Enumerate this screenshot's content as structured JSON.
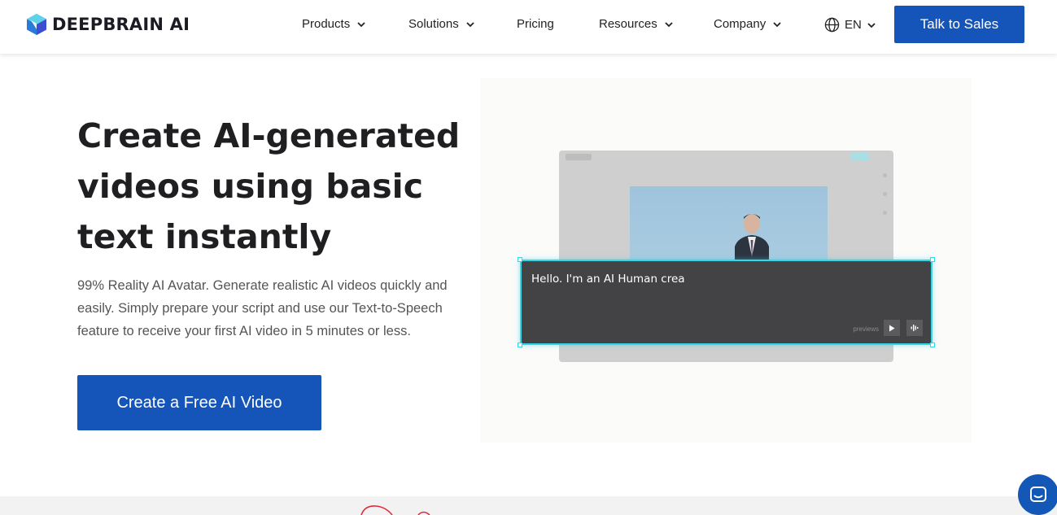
{
  "brand": {
    "name": "DEEPBRAIN AI",
    "accent": "#1555b9",
    "highlight": "#2ed8e6"
  },
  "nav": {
    "items": [
      {
        "label": "Products",
        "has_dropdown": true
      },
      {
        "label": "Solutions",
        "has_dropdown": true
      },
      {
        "label": "Pricing",
        "has_dropdown": false
      },
      {
        "label": "Resources",
        "has_dropdown": true
      },
      {
        "label": "Company",
        "has_dropdown": true
      }
    ],
    "language": "EN",
    "cta_label": "Talk to Sales"
  },
  "hero": {
    "title": "Create AI-generated videos using basic text instantly",
    "subtitle": "99% Reality AI Avatar. Generate realistic AI videos quickly and easily. Simply prepare your script and use our Text-to-Speech feature to receive your first AI video in 5 minutes or less.",
    "cta_label": "Create a Free AI Video"
  },
  "demo": {
    "script_text": "Hello.  I'm an  AI Human crea",
    "previews_label": "previews"
  },
  "icons": [
    "logo-icon",
    "chevron-down-icon",
    "globe-icon",
    "play-icon",
    "audio-wave-icon",
    "chat-icon"
  ]
}
